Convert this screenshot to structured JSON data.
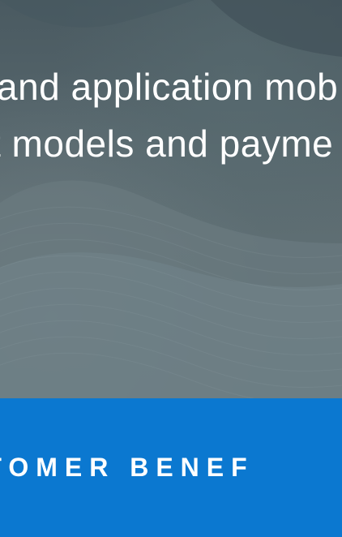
{
  "hero": {
    "line1": "and application mob",
    "line2": "t models and payme"
  },
  "benefits": {
    "title": "STOMER BENEF"
  },
  "colors": {
    "band": "#0b78d0",
    "text": "#ffffff"
  }
}
